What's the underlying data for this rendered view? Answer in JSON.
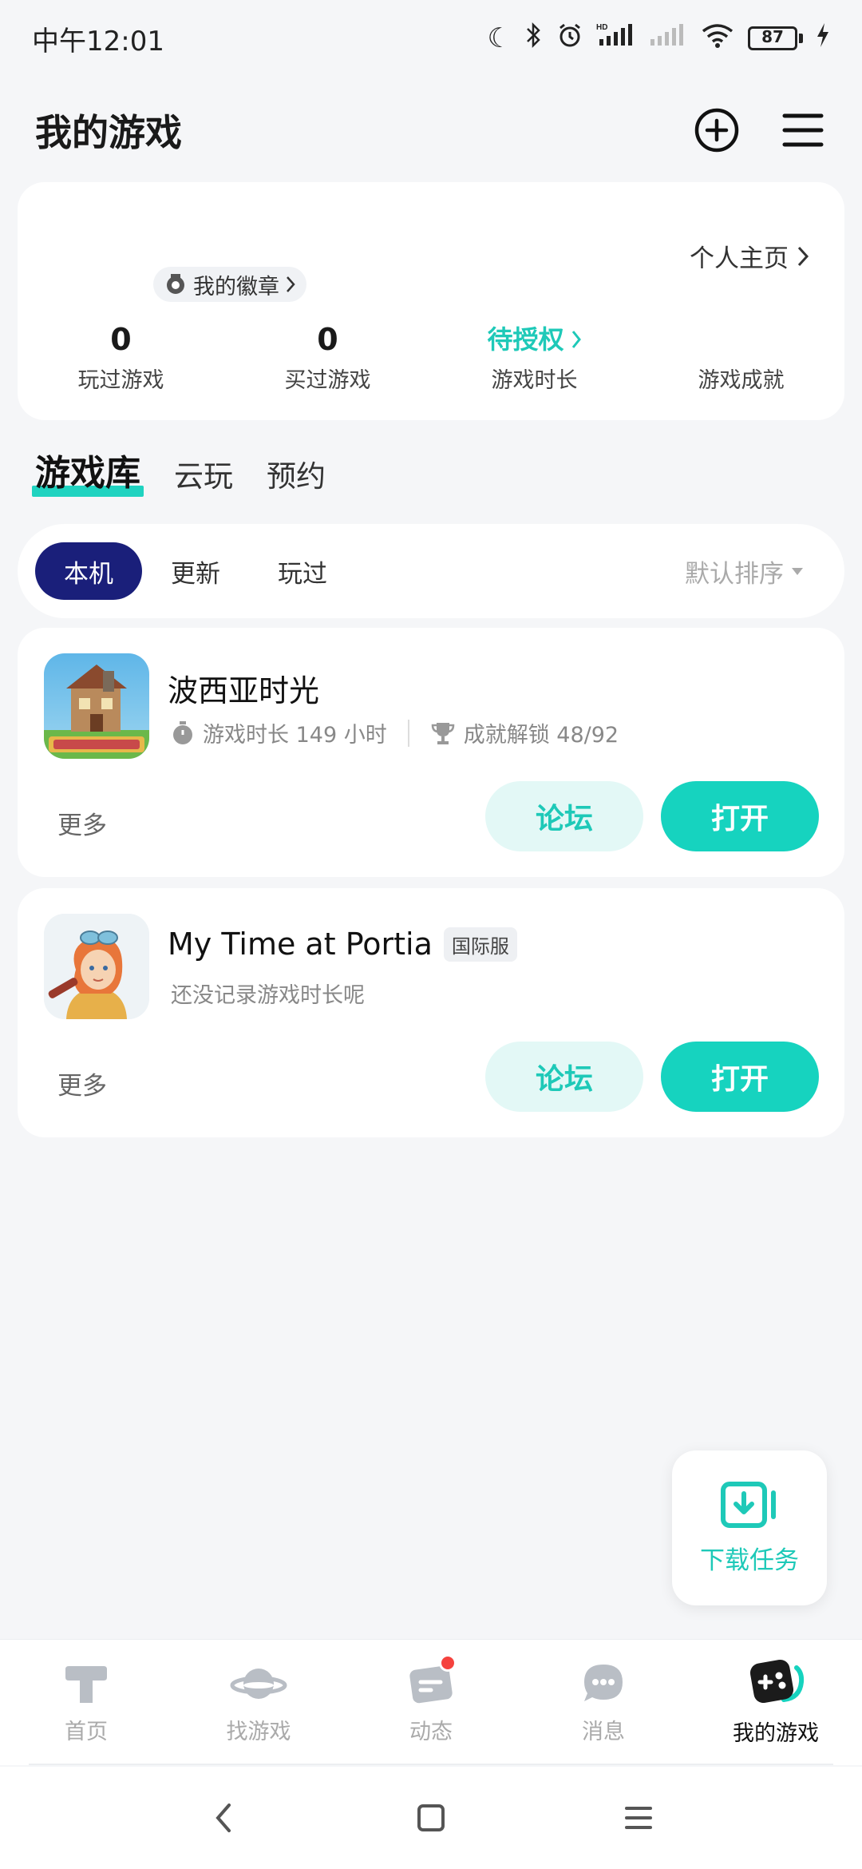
{
  "status_bar": {
    "time": "中午12:01",
    "battery": "87"
  },
  "header": {
    "title": "我的游戏"
  },
  "profile": {
    "homepage_link": "个人主页",
    "badge_label": "我的徽章",
    "stats": [
      {
        "value": "0",
        "label": "玩过游戏"
      },
      {
        "value": "0",
        "label": "买过游戏"
      },
      {
        "value": "待授权",
        "label": "游戏时长"
      },
      {
        "value": "",
        "label": "游戏成就"
      }
    ]
  },
  "tabs": [
    "游戏库",
    "云玩",
    "预约"
  ],
  "filters": {
    "chips": [
      "本机",
      "更新",
      "玩过"
    ],
    "sort_label": "默认排序"
  },
  "games": [
    {
      "title": "波西亚时光",
      "tag": "",
      "playtime": "游戏时长 149 小时",
      "achievements": "成就解锁 48/92",
      "note": "",
      "more": "更多",
      "forum": "论坛",
      "open": "打开"
    },
    {
      "title": "My Time at Portia",
      "tag": "国际服",
      "playtime": "",
      "achievements": "",
      "note": "还没记录游戏时长呢",
      "more": "更多",
      "forum": "论坛",
      "open": "打开"
    }
  ],
  "download_task": {
    "label": "下载任务"
  },
  "bottom_nav": {
    "items": [
      {
        "label": "首页",
        "icon": "home-icon"
      },
      {
        "label": "找游戏",
        "icon": "planet-icon"
      },
      {
        "label": "动态",
        "icon": "feed-icon"
      },
      {
        "label": "消息",
        "icon": "message-icon"
      },
      {
        "label": "我的游戏",
        "icon": "gamepad-icon"
      }
    ]
  },
  "colors": {
    "accent": "#16d3bf",
    "chip_active": "#1a1f7a",
    "badge_dot": "#f5423e"
  }
}
